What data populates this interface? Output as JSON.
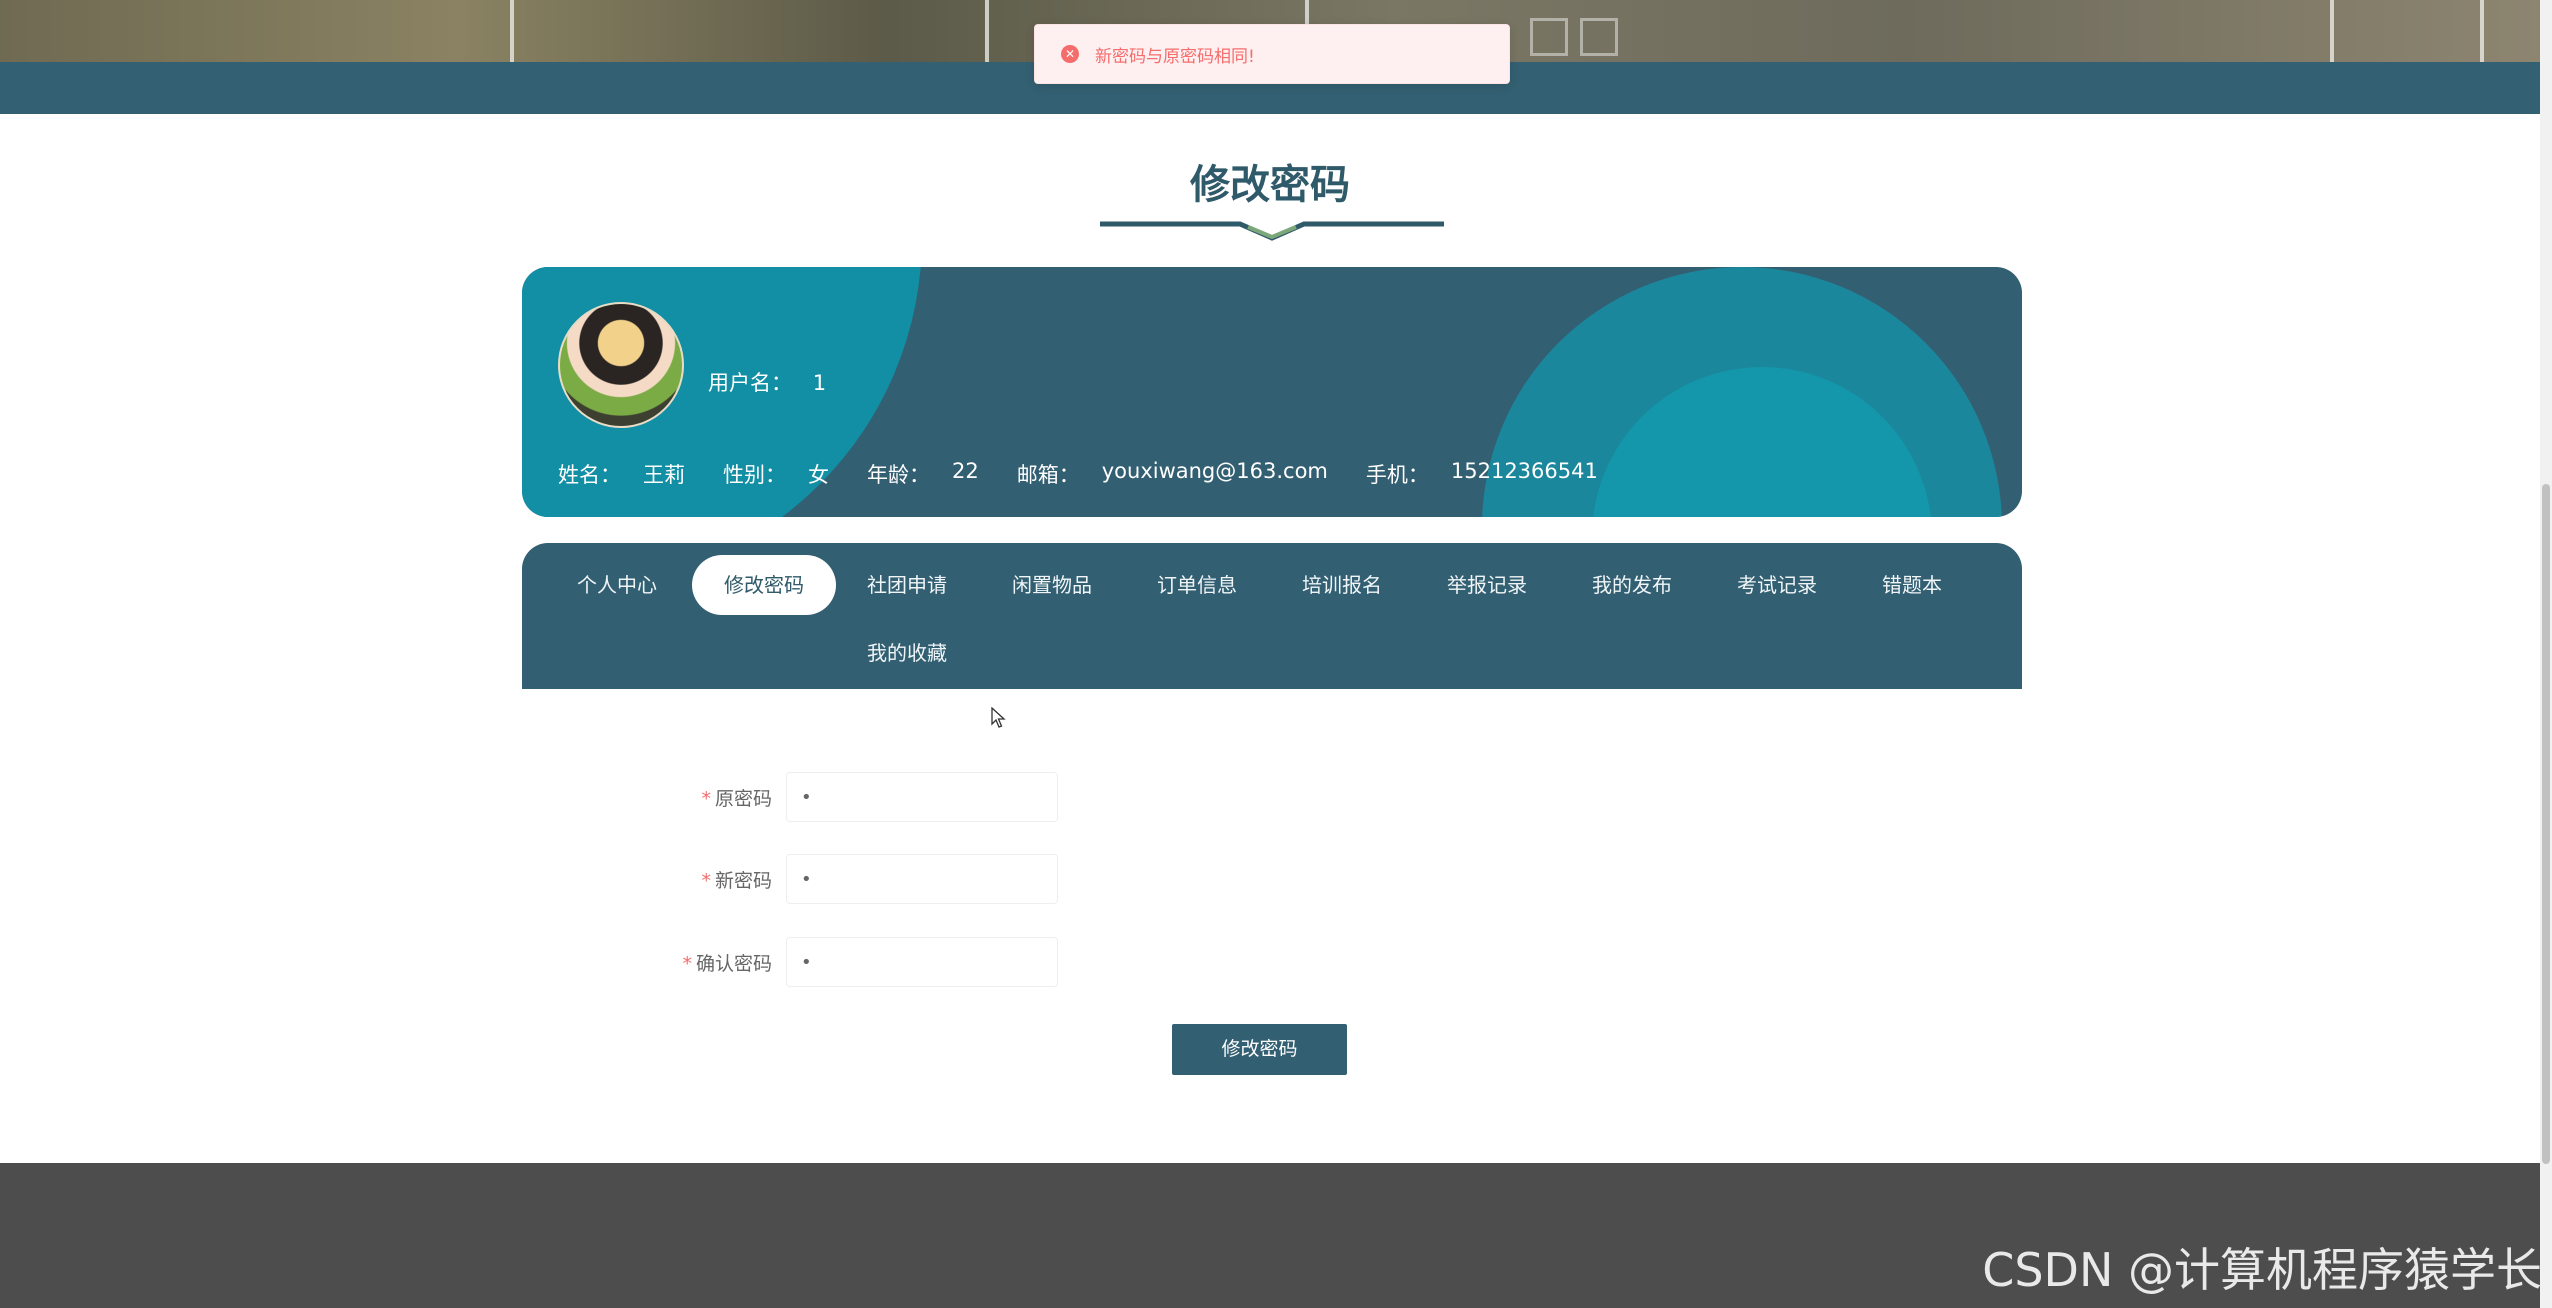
{
  "toast": {
    "message": "新密码与原密码相同!",
    "icon": "error-circle-icon"
  },
  "page_title": "修改密码",
  "profile": {
    "username_label": "用户名：",
    "username": "1",
    "fields": [
      {
        "label": "姓名：",
        "value": "王莉"
      },
      {
        "label": "性别：",
        "value": "女"
      },
      {
        "label": "年龄：",
        "value": "22"
      },
      {
        "label": "邮箱：",
        "value": "youxiwang@163.com"
      },
      {
        "label": "手机：",
        "value": "15212366541"
      }
    ]
  },
  "nav": {
    "tabs": [
      {
        "label": "个人中心"
      },
      {
        "label": "修改密码",
        "active": true
      },
      {
        "label": "社团申请"
      },
      {
        "label": "闲置物品"
      },
      {
        "label": "订单信息"
      },
      {
        "label": "培训报名"
      },
      {
        "label": "举报记录"
      },
      {
        "label": "我的发布"
      },
      {
        "label": "考试记录"
      },
      {
        "label": "错题本"
      },
      {
        "label": "我的收藏"
      }
    ]
  },
  "form": {
    "required_mark": "*",
    "old_password": {
      "label": "原密码",
      "value": "•"
    },
    "new_password": {
      "label": "新密码",
      "value": "•"
    },
    "confirm_password": {
      "label": "确认密码",
      "value": "•"
    },
    "submit_label": "修改密码"
  },
  "watermark": "CSDN @计算机程序猿学长",
  "colors": {
    "primary": "#335f72",
    "accent_teal": "#128fa4",
    "error": "#f56c6c",
    "footer": "#4d4d4d"
  }
}
